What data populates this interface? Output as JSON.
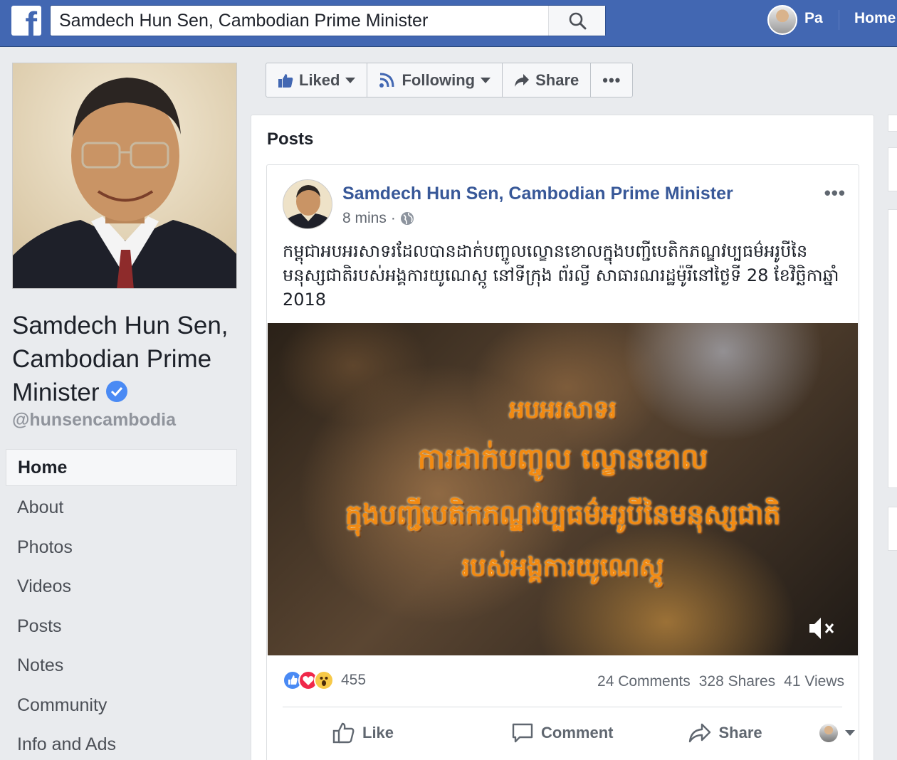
{
  "search": {
    "value": "Samdech Hun Sen, Cambodian Prime Minister"
  },
  "topnav": {
    "user_name": "Pa",
    "home_label": "Home",
    "logo_letter": "f"
  },
  "page": {
    "name": "Samdech Hun Sen, Cambodian Prime Minister",
    "handle": "@hunsencambodia",
    "verified": true
  },
  "nav": {
    "items": [
      {
        "label": "Home"
      },
      {
        "label": "About"
      },
      {
        "label": "Photos"
      },
      {
        "label": "Videos"
      },
      {
        "label": "Posts"
      },
      {
        "label": "Notes"
      },
      {
        "label": "Community"
      },
      {
        "label": "Info and Ads"
      }
    ]
  },
  "actions": {
    "liked": "Liked",
    "following": "Following",
    "share": "Share",
    "more": "•••"
  },
  "posts": {
    "title": "Posts",
    "post": {
      "author": "Samdech Hun Sen, Cambodian Prime Minister",
      "time": "8 mins",
      "separator": "·",
      "menu": "•••",
      "text": "កម្ពុជាអបអរសាទរដែលបានដាក់បញ្ចូលល្ខោនខោលក្នុងបញ្ជីបេតិកភណ្ឌវប្បធម៌អរូបីនៃមនុស្សជាតិរបស់អង្គការយូណេស្កូ នៅទីក្រុង ព័រល្វី សាធារណរដ្ឋម៉ូរីនៅថ្ងៃទី 28 ខែវិច្ឆិកាឆ្នាំ 2018",
      "video": {
        "line1": "អបអរសាទរ",
        "line2": "ការដាក់បញ្ចូល ល្ខោនខោល",
        "line3": "ក្នុងបញ្ជីបេតិកភណ្ឌវប្បធម៌អរូបីនៃមនុស្សជាតិ",
        "line4": "របស់អង្គការយូណេស្កូ"
      },
      "reaction_count": "455",
      "comments": "24 Comments",
      "shares": "328 Shares",
      "views": "41 Views",
      "like_label": "Like",
      "comment_label": "Comment",
      "share_label": "Share"
    }
  },
  "colors": {
    "brand": "#4267b2",
    "link": "#385898",
    "video_text": "#f28a12"
  }
}
